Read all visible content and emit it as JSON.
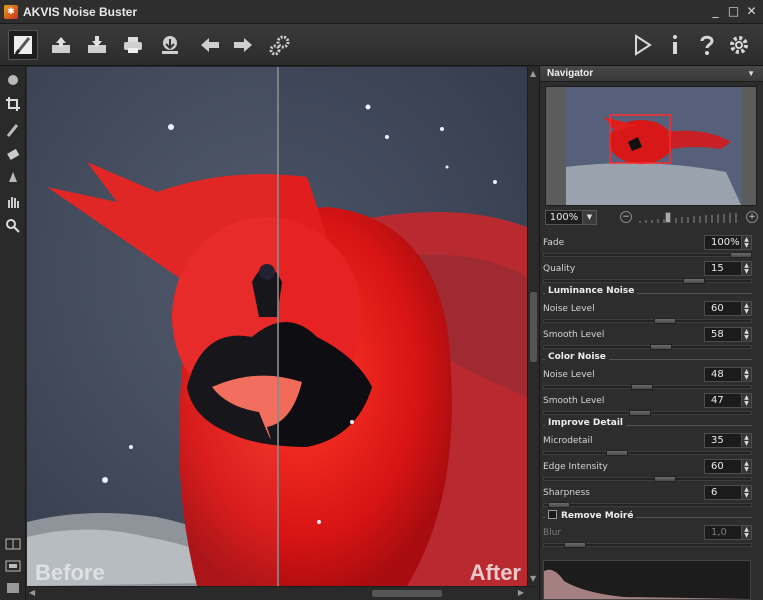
{
  "window": {
    "title": "AKVIS Noise Buster",
    "controls": [
      "_",
      "□",
      "✕"
    ]
  },
  "toolbar": {
    "left_buttons": [
      "brush-tool",
      "open-image",
      "save-image",
      "print-image",
      "share-image",
      "undo",
      "redo",
      "settings-gear"
    ],
    "right_buttons": [
      "run",
      "info",
      "help",
      "preferences"
    ]
  },
  "tools": [
    "nav-hand",
    "crop",
    "brush",
    "eraser",
    "history-brush",
    "hand",
    "zoom"
  ],
  "canvas": {
    "before_label": "Before",
    "after_label": "After"
  },
  "navigator": {
    "title": "Navigator",
    "zoom": "100%"
  },
  "params": {
    "fade": {
      "label": "Fade",
      "value": "100%"
    },
    "quality": {
      "label": "Quality",
      "value": "15"
    },
    "luminance_noise": {
      "title": "Luminance Noise",
      "noise_level": {
        "label": "Noise Level",
        "value": "60"
      },
      "smooth_level": {
        "label": "Smooth Level",
        "value": "58"
      }
    },
    "color_noise": {
      "title": "Color Noise",
      "noise_level": {
        "label": "Noise Level",
        "value": "48"
      },
      "smooth_level": {
        "label": "Smooth Level",
        "value": "47"
      }
    },
    "improve_detail": {
      "title": "Improve Detail",
      "microdetail": {
        "label": "Microdetail",
        "value": "35"
      },
      "edge_intensity": {
        "label": "Edge Intensity",
        "value": "60"
      },
      "sharpness": {
        "label": "Sharpness",
        "value": "6"
      }
    },
    "remove_moire": {
      "title": "Remove Moiré",
      "checked": false,
      "blur": {
        "label": "Blur",
        "value": "1,0"
      }
    }
  },
  "colors": {
    "accent_red": "#e02020",
    "panel_bg": "#2d2d2d"
  }
}
